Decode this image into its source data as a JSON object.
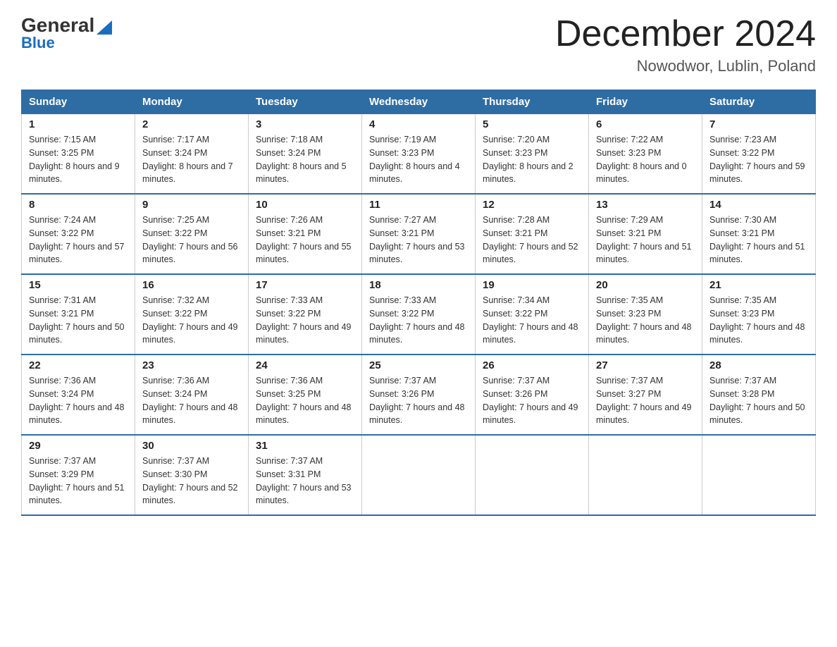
{
  "header": {
    "logo_general": "General",
    "logo_blue": "Blue",
    "title": "December 2024",
    "subtitle": "Nowodwor, Lublin, Poland"
  },
  "days_of_week": [
    "Sunday",
    "Monday",
    "Tuesday",
    "Wednesday",
    "Thursday",
    "Friday",
    "Saturday"
  ],
  "weeks": [
    [
      {
        "day": "1",
        "sunrise": "7:15 AM",
        "sunset": "3:25 PM",
        "daylight": "8 hours and 9 minutes."
      },
      {
        "day": "2",
        "sunrise": "7:17 AM",
        "sunset": "3:24 PM",
        "daylight": "8 hours and 7 minutes."
      },
      {
        "day": "3",
        "sunrise": "7:18 AM",
        "sunset": "3:24 PM",
        "daylight": "8 hours and 5 minutes."
      },
      {
        "day": "4",
        "sunrise": "7:19 AM",
        "sunset": "3:23 PM",
        "daylight": "8 hours and 4 minutes."
      },
      {
        "day": "5",
        "sunrise": "7:20 AM",
        "sunset": "3:23 PM",
        "daylight": "8 hours and 2 minutes."
      },
      {
        "day": "6",
        "sunrise": "7:22 AM",
        "sunset": "3:23 PM",
        "daylight": "8 hours and 0 minutes."
      },
      {
        "day": "7",
        "sunrise": "7:23 AM",
        "sunset": "3:22 PM",
        "daylight": "7 hours and 59 minutes."
      }
    ],
    [
      {
        "day": "8",
        "sunrise": "7:24 AM",
        "sunset": "3:22 PM",
        "daylight": "7 hours and 57 minutes."
      },
      {
        "day": "9",
        "sunrise": "7:25 AM",
        "sunset": "3:22 PM",
        "daylight": "7 hours and 56 minutes."
      },
      {
        "day": "10",
        "sunrise": "7:26 AM",
        "sunset": "3:21 PM",
        "daylight": "7 hours and 55 minutes."
      },
      {
        "day": "11",
        "sunrise": "7:27 AM",
        "sunset": "3:21 PM",
        "daylight": "7 hours and 53 minutes."
      },
      {
        "day": "12",
        "sunrise": "7:28 AM",
        "sunset": "3:21 PM",
        "daylight": "7 hours and 52 minutes."
      },
      {
        "day": "13",
        "sunrise": "7:29 AM",
        "sunset": "3:21 PM",
        "daylight": "7 hours and 51 minutes."
      },
      {
        "day": "14",
        "sunrise": "7:30 AM",
        "sunset": "3:21 PM",
        "daylight": "7 hours and 51 minutes."
      }
    ],
    [
      {
        "day": "15",
        "sunrise": "7:31 AM",
        "sunset": "3:21 PM",
        "daylight": "7 hours and 50 minutes."
      },
      {
        "day": "16",
        "sunrise": "7:32 AM",
        "sunset": "3:22 PM",
        "daylight": "7 hours and 49 minutes."
      },
      {
        "day": "17",
        "sunrise": "7:33 AM",
        "sunset": "3:22 PM",
        "daylight": "7 hours and 49 minutes."
      },
      {
        "day": "18",
        "sunrise": "7:33 AM",
        "sunset": "3:22 PM",
        "daylight": "7 hours and 48 minutes."
      },
      {
        "day": "19",
        "sunrise": "7:34 AM",
        "sunset": "3:22 PM",
        "daylight": "7 hours and 48 minutes."
      },
      {
        "day": "20",
        "sunrise": "7:35 AM",
        "sunset": "3:23 PM",
        "daylight": "7 hours and 48 minutes."
      },
      {
        "day": "21",
        "sunrise": "7:35 AM",
        "sunset": "3:23 PM",
        "daylight": "7 hours and 48 minutes."
      }
    ],
    [
      {
        "day": "22",
        "sunrise": "7:36 AM",
        "sunset": "3:24 PM",
        "daylight": "7 hours and 48 minutes."
      },
      {
        "day": "23",
        "sunrise": "7:36 AM",
        "sunset": "3:24 PM",
        "daylight": "7 hours and 48 minutes."
      },
      {
        "day": "24",
        "sunrise": "7:36 AM",
        "sunset": "3:25 PM",
        "daylight": "7 hours and 48 minutes."
      },
      {
        "day": "25",
        "sunrise": "7:37 AM",
        "sunset": "3:26 PM",
        "daylight": "7 hours and 48 minutes."
      },
      {
        "day": "26",
        "sunrise": "7:37 AM",
        "sunset": "3:26 PM",
        "daylight": "7 hours and 49 minutes."
      },
      {
        "day": "27",
        "sunrise": "7:37 AM",
        "sunset": "3:27 PM",
        "daylight": "7 hours and 49 minutes."
      },
      {
        "day": "28",
        "sunrise": "7:37 AM",
        "sunset": "3:28 PM",
        "daylight": "7 hours and 50 minutes."
      }
    ],
    [
      {
        "day": "29",
        "sunrise": "7:37 AM",
        "sunset": "3:29 PM",
        "daylight": "7 hours and 51 minutes."
      },
      {
        "day": "30",
        "sunrise": "7:37 AM",
        "sunset": "3:30 PM",
        "daylight": "7 hours and 52 minutes."
      },
      {
        "day": "31",
        "sunrise": "7:37 AM",
        "sunset": "3:31 PM",
        "daylight": "7 hours and 53 minutes."
      },
      null,
      null,
      null,
      null
    ]
  ]
}
